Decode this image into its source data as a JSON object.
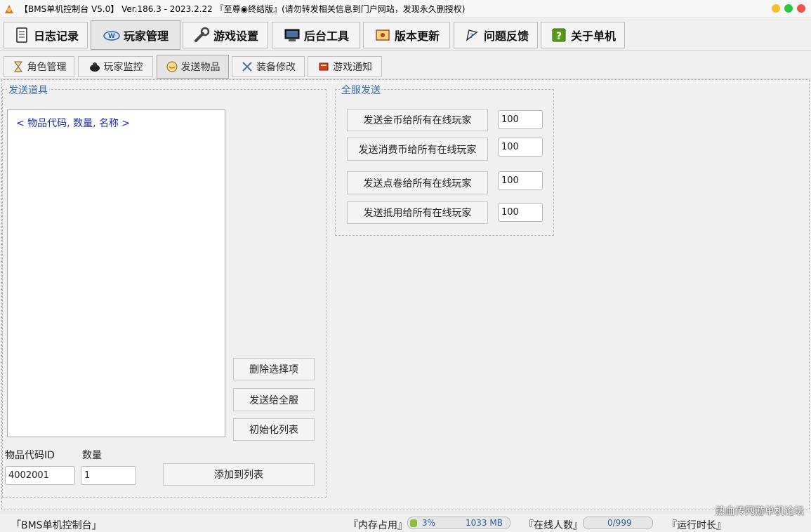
{
  "window": {
    "title": "【BMS单机控制台 V5.0】 Ver.186.3 - 2023.2.22 『至尊◉终结版』(请勿转发相关信息到门户网站，发现永久删授权)"
  },
  "main_tabs": [
    {
      "label": "日志记录",
      "icon": "notebook-icon"
    },
    {
      "label": "玩家管理",
      "icon": "player-icon"
    },
    {
      "label": "游戏设置",
      "icon": "wrench-icon"
    },
    {
      "label": "后台工具",
      "icon": "computer-icon"
    },
    {
      "label": "版本更新",
      "icon": "scroll-icon"
    },
    {
      "label": "问题反馈",
      "icon": "feedback-icon"
    },
    {
      "label": "关于单机",
      "icon": "help-icon"
    }
  ],
  "sub_tabs": [
    {
      "label": "角色管理",
      "icon": "hourglass-icon"
    },
    {
      "label": "玩家监控",
      "icon": "monitor-icon"
    },
    {
      "label": "发送物品",
      "icon": "gift-icon"
    },
    {
      "label": "装备修改",
      "icon": "gear-icon"
    },
    {
      "label": "游戏通知",
      "icon": "notice-icon"
    }
  ],
  "send_items": {
    "title": "发送道具",
    "list_placeholder": "< 物品代码, 数量, 名称 >",
    "delete_button": "删除选择项",
    "send_all_button": "发送给全服",
    "init_button": "初始化列表",
    "code_label": "物品代码ID",
    "qty_label": "数量",
    "code_value": "4002001",
    "qty_value": "1",
    "add_button": "添加到列表"
  },
  "server_send": {
    "title": "全服发送",
    "rows": [
      {
        "label": "发送金币给所有在线玩家",
        "value": "100"
      },
      {
        "label": "发送消费币给所有在线玩家",
        "value": "100"
      },
      {
        "label": "发送点卷给所有在线玩家",
        "value": "100"
      },
      {
        "label": "发送抵用给所有在线玩家",
        "value": "100"
      }
    ]
  },
  "status": {
    "app_name": "「BMS单机控制台」",
    "memory_label": "『内存占用』",
    "memory_percent": "3%",
    "memory_value": "1033 MB",
    "online_label": "『在线人数』",
    "online_value": "0/999",
    "runtime_label": "『运行时长』",
    "watermark": "热血传网游单机论坛"
  }
}
